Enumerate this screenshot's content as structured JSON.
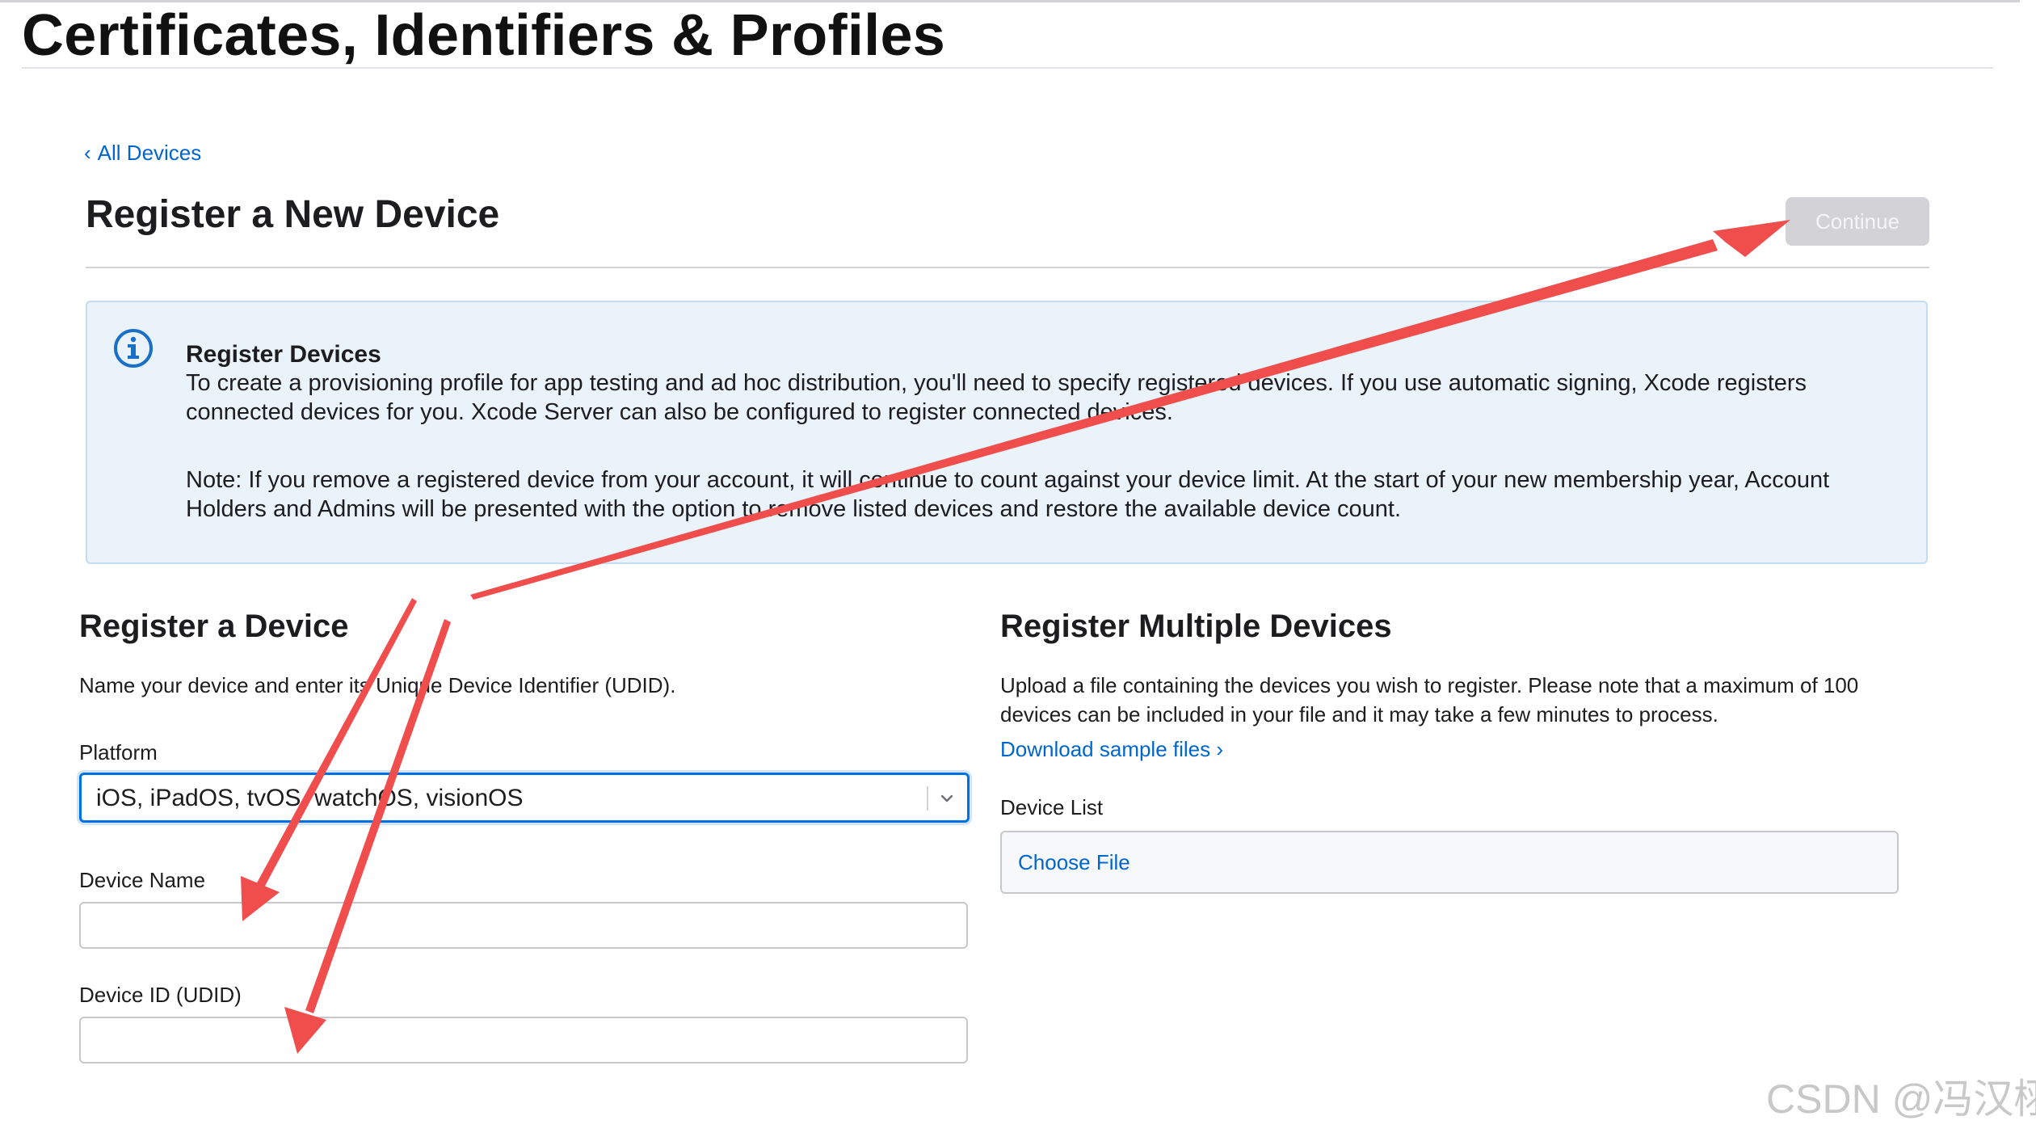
{
  "site": {
    "title": "Certificates, Identifiers & Profiles"
  },
  "nav": {
    "back_chevron": "‹",
    "back_label": "All Devices"
  },
  "header": {
    "title": "Register a New Device",
    "continue_label": "Continue"
  },
  "info": {
    "icon": "info-circle-icon",
    "title": "Register Devices",
    "paragraph1": "To create a provisioning profile for app testing and ad hoc distribution, you'll need to specify registered devices. If you use automatic signing, Xcode registers connected devices for you. Xcode Server can also be configured to register connected devices.",
    "paragraph2": "Note: If you remove a registered device from your account, it will continue to count against your device limit. At the start of your new membership year, Account Holders and Admins will be presented with the option to remove listed devices and restore the available device count."
  },
  "single": {
    "title": "Register a Device",
    "description": "Name your device and enter its Unique Device Identifier (UDID).",
    "platform_label": "Platform",
    "platform_value": "iOS, iPadOS, tvOS, watchOS, visionOS",
    "device_name_label": "Device Name",
    "device_name_value": "",
    "device_id_label": "Device ID (UDID)",
    "device_id_value": ""
  },
  "multiple": {
    "title": "Register Multiple Devices",
    "description": "Upload a file containing the devices you wish to register. Please note that a maximum of 100 devices can be included in your file and it may take a few minutes to process.",
    "download_link": "Download sample files ›",
    "device_list_label": "Device List",
    "choose_file_label": "Choose File"
  },
  "watermark": "CSDN @冯汉栩",
  "colors": {
    "link": "#0066cc",
    "focus": "#0071e3",
    "info_bg": "#eaf2fa",
    "info_icon": "#1a6fc7",
    "disabled_button": "#d2d2d7",
    "annotation_arrow": "#f04d4d"
  }
}
